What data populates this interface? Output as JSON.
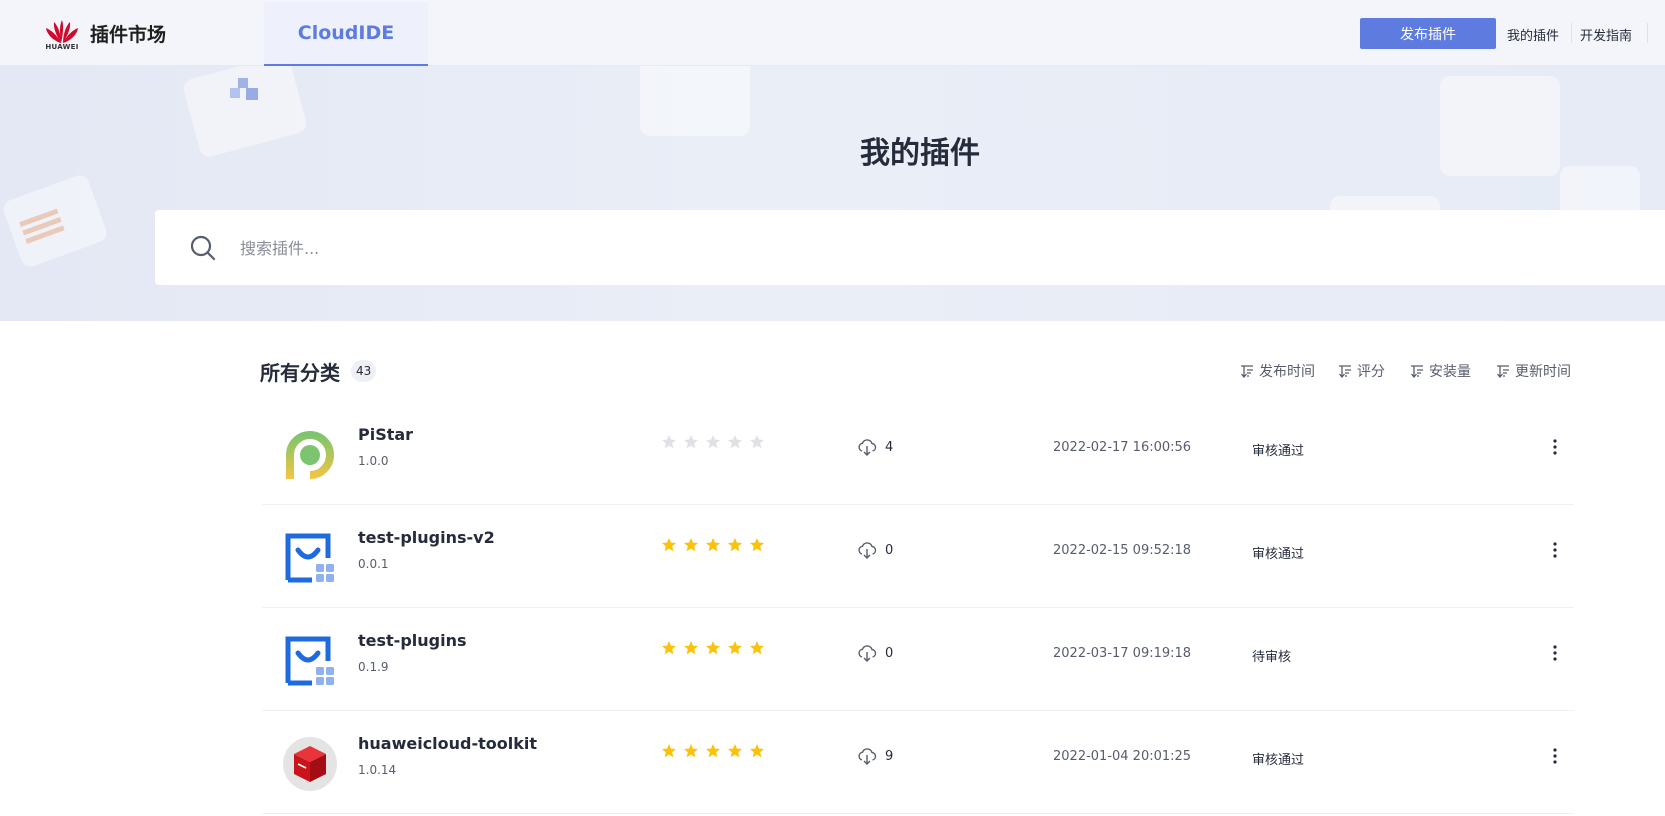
{
  "header": {
    "brand_text": "HUAWEI",
    "market_title": "插件市场",
    "tab_label": "CloudIDE",
    "publish_label": "发布插件",
    "my_plugins_label": "我的插件",
    "dev_guide_label": "开发指南"
  },
  "banner": {
    "title": "我的插件",
    "search_placeholder": "搜索插件..."
  },
  "list": {
    "category_label": "所有分类",
    "count": "43",
    "sort_options": [
      "发布时间",
      "评分",
      "安装量",
      "更新时间"
    ],
    "plugins": [
      {
        "name": "PiStar",
        "version": "1.0.0",
        "rating": 0,
        "downloads": "4",
        "date": "2022-02-17 16:00:56",
        "status": "审核通过",
        "icon": "pistar-logo-icon"
      },
      {
        "name": "test-plugins-v2",
        "version": "0.0.1",
        "rating": 5,
        "downloads": "0",
        "date": "2022-02-15 09:52:18",
        "status": "审核通过",
        "icon": "plugin-default-icon"
      },
      {
        "name": "test-plugins",
        "version": "0.1.9",
        "rating": 5,
        "downloads": "0",
        "date": "2022-03-17 09:19:18",
        "status": "待审核",
        "icon": "plugin-default-icon"
      },
      {
        "name": "huaweicloud-toolkit",
        "version": "1.0.14",
        "rating": 5,
        "downloads": "9",
        "date": "2022-01-04 20:01:25",
        "status": "审核通过",
        "icon": "red-cube-icon"
      }
    ]
  },
  "colors": {
    "accent": "#5e7ce0",
    "star_on": "#fac20a",
    "star_off": "#dfe1e6",
    "huawei_red": "#cf0a2c"
  }
}
